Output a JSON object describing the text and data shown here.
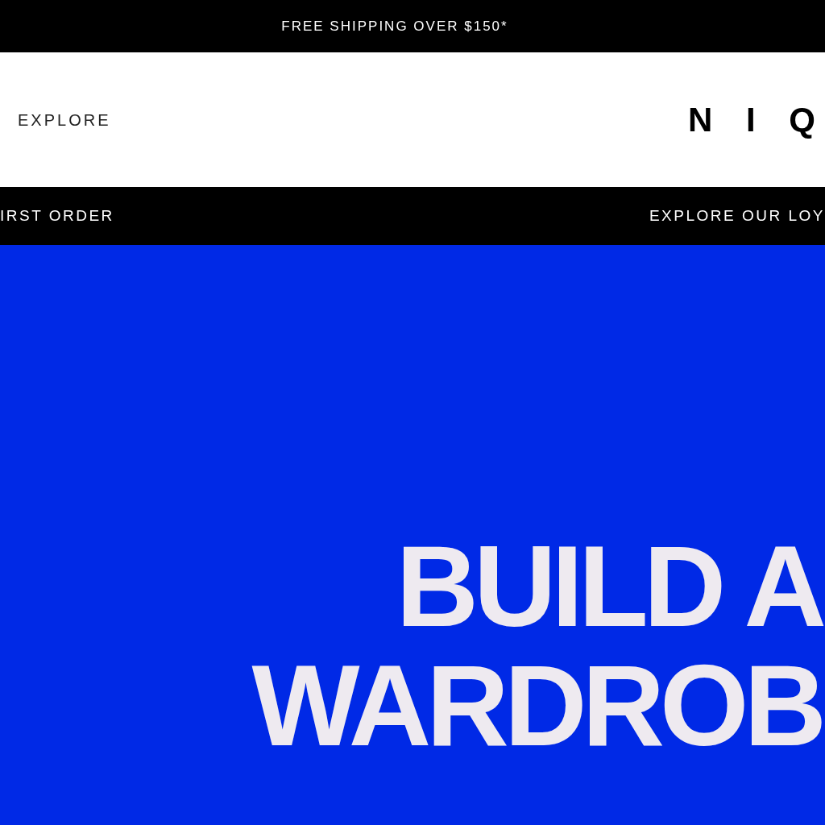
{
  "announcement": "FREE SHIPPING OVER $150*",
  "header": {
    "nav_link": "EXPLORE",
    "logo": "N I Q"
  },
  "promo_bar": [
    "IRST ORDER",
    "EXPLORE OUR LOY"
  ],
  "hero": {
    "lines": [
      "BUILD A",
      "WARDROB"
    ]
  }
}
